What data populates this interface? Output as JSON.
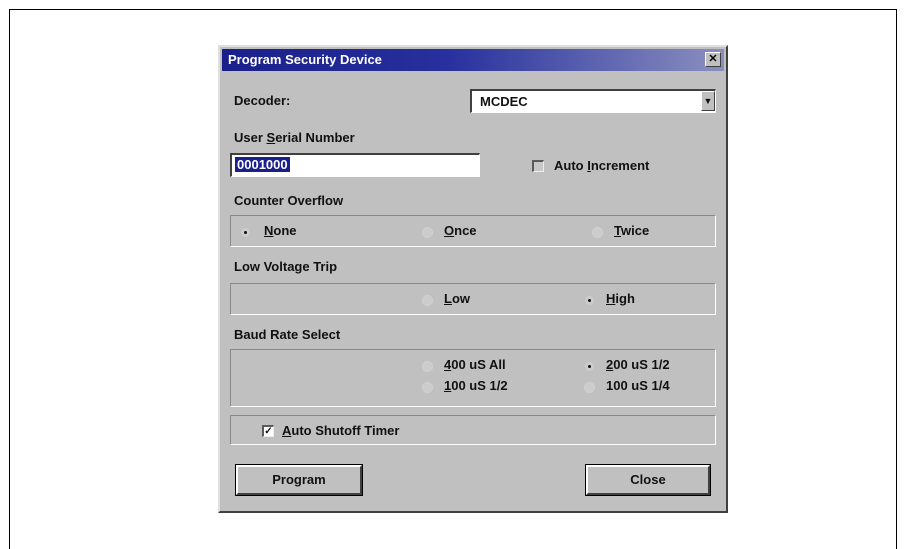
{
  "dialog": {
    "title": "Program Security Device",
    "close_glyph": "✕"
  },
  "decoder": {
    "label": "Decoder:",
    "value": "MCDEC",
    "arrow_glyph": "▼"
  },
  "serial": {
    "label_pre": "User ",
    "label_ul": "S",
    "label_post": "erial Number",
    "value": "0001000",
    "auto_increment": {
      "pre": "Auto ",
      "ul": "I",
      "post": "ncrement",
      "checked": false
    }
  },
  "counter_overflow": {
    "label": "Counter Overflow",
    "options": [
      {
        "ul": "N",
        "rest": "one",
        "selected": true
      },
      {
        "ul": "O",
        "rest": "nce",
        "selected": false
      },
      {
        "ul": "T",
        "rest": "wice",
        "selected": false
      }
    ]
  },
  "low_voltage": {
    "label": "Low Voltage Trip",
    "options": [
      {
        "ul": "L",
        "rest": "ow",
        "selected": false
      },
      {
        "ul": "H",
        "rest": "igh",
        "selected": true
      }
    ]
  },
  "baud_rate": {
    "label": "Baud Rate Select",
    "options": [
      {
        "ul": "4",
        "rest": "00 uS All",
        "selected": false
      },
      {
        "ul": "2",
        "rest": "00 uS 1/2",
        "selected": true
      },
      {
        "ul": "1",
        "rest": "00 uS 1/2",
        "selected": false
      },
      {
        "ul": "",
        "rest": "100 uS 1/4",
        "selected": false
      }
    ]
  },
  "auto_shutoff": {
    "ul": "A",
    "rest": "uto Shutoff Timer",
    "checked": true,
    "check_glyph": "✓"
  },
  "buttons": {
    "program": "Program",
    "close": "Close"
  }
}
